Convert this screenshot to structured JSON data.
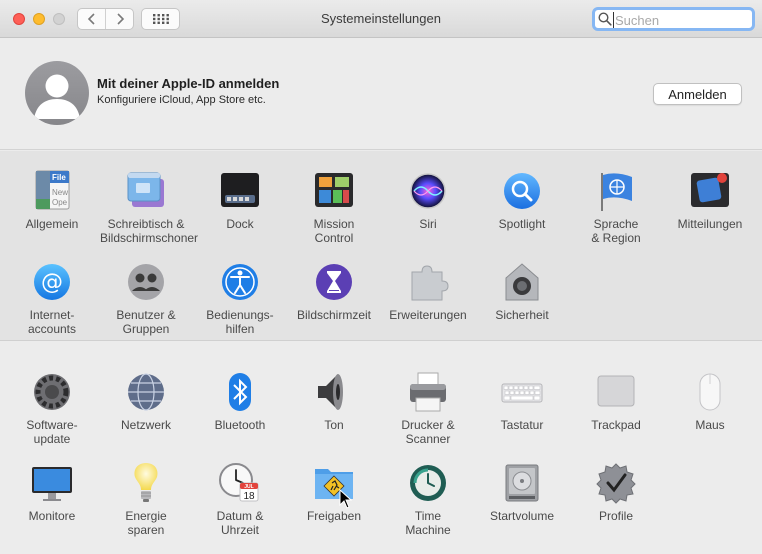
{
  "window": {
    "title": "Systemeinstellungen",
    "search": {
      "placeholder": "Suchen",
      "value": ""
    }
  },
  "apple_id": {
    "title": "Mit deiner Apple-ID anmelden",
    "subtitle": "Konfiguriere iCloud, App Store etc.",
    "button": "Anmelden"
  },
  "section1": [
    {
      "line1": "Allgemein",
      "line2": "",
      "icon": "general-icon"
    },
    {
      "line1": "Schreibtisch &",
      "line2": "Bildschirmschoner",
      "icon": "desktop-screensaver-icon"
    },
    {
      "line1": "Dock",
      "line2": "",
      "icon": "dock-icon"
    },
    {
      "line1": "Mission",
      "line2": "Control",
      "icon": "mission-control-icon"
    },
    {
      "line1": "Siri",
      "line2": "",
      "icon": "siri-icon"
    },
    {
      "line1": "Spotlight",
      "line2": "",
      "icon": "spotlight-icon"
    },
    {
      "line1": "Sprache",
      "line2": "& Region",
      "icon": "language-region-icon"
    },
    {
      "line1": "Mitteilungen",
      "line2": "",
      "icon": "notifications-icon"
    },
    {
      "line1": "Internet-",
      "line2": "accounts",
      "icon": "internet-accounts-icon"
    },
    {
      "line1": "Benutzer &",
      "line2": "Gruppen",
      "icon": "users-groups-icon"
    },
    {
      "line1": "Bedienungs-",
      "line2": "hilfen",
      "icon": "accessibility-icon"
    },
    {
      "line1": "Bildschirmzeit",
      "line2": "",
      "icon": "screen-time-icon"
    },
    {
      "line1": "Erweiterungen",
      "line2": "",
      "icon": "extensions-icon"
    },
    {
      "line1": "Sicherheit",
      "line2": "",
      "icon": "security-icon"
    }
  ],
  "section2": [
    {
      "line1": "Software-",
      "line2": "update",
      "icon": "software-update-icon"
    },
    {
      "line1": "Netzwerk",
      "line2": "",
      "icon": "network-icon"
    },
    {
      "line1": "Bluetooth",
      "line2": "",
      "icon": "bluetooth-icon"
    },
    {
      "line1": "Ton",
      "line2": "",
      "icon": "sound-icon"
    },
    {
      "line1": "Drucker &",
      "line2": "Scanner",
      "icon": "printers-scanners-icon"
    },
    {
      "line1": "Tastatur",
      "line2": "",
      "icon": "keyboard-icon"
    },
    {
      "line1": "Trackpad",
      "line2": "",
      "icon": "trackpad-icon"
    },
    {
      "line1": "Maus",
      "line2": "",
      "icon": "mouse-icon"
    },
    {
      "line1": "Monitore",
      "line2": "",
      "icon": "displays-icon"
    },
    {
      "line1": "Energie",
      "line2": "sparen",
      "icon": "energy-saver-icon"
    },
    {
      "line1": "Datum &",
      "line2": "Uhrzeit",
      "icon": "date-time-icon"
    },
    {
      "line1": "Freigaben",
      "line2": "",
      "icon": "sharing-icon"
    },
    {
      "line1": "Time",
      "line2": "Machine",
      "icon": "time-machine-icon"
    },
    {
      "line1": "Startvolume",
      "line2": "",
      "icon": "startup-disk-icon"
    },
    {
      "line1": "Profile",
      "line2": "",
      "icon": "profiles-icon"
    }
  ],
  "icon_text": {
    "general_file": "File",
    "general_new": "New",
    "general_ope": "Ope",
    "calendar_month": "JUL",
    "calendar_day": "18"
  }
}
